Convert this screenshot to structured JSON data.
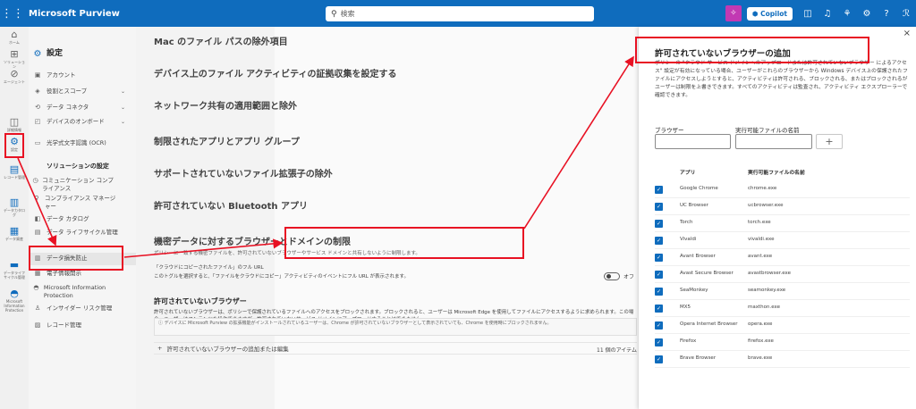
{
  "topbar": {
    "app_name": "Microsoft Purview",
    "search_placeholder": "検索",
    "copilot_label": "Copilot",
    "accent": "#0f6cbd"
  },
  "rail": {
    "items": [
      {
        "icon": "home-icon",
        "label": "ホーム"
      },
      {
        "icon": "solutions-icon",
        "label": "ソリューション"
      },
      {
        "icon": "agents-icon",
        "label": "エージェント"
      },
      {
        "icon": "explorer-icon",
        "label": "詳細情報"
      },
      {
        "icon": "settings-icon",
        "label": "設定"
      },
      {
        "icon": "records-icon",
        "label": "レコード管理"
      },
      {
        "icon": "catalog-icon",
        "label": "データカタログ"
      },
      {
        "icon": "lifecycle-icon",
        "label": "データ資産"
      },
      {
        "icon": "dlp-icon",
        "label": "データライフサイクル管理"
      },
      {
        "icon": "mip-icon",
        "label": "Microsoft Information Protection"
      }
    ]
  },
  "nav": {
    "title": "設定",
    "items": [
      {
        "icon": "account-icon",
        "label": "アカウント"
      },
      {
        "icon": "roles-icon",
        "label": "役割とスコープ"
      },
      {
        "icon": "connector-icon",
        "label": "データ コネクタ"
      },
      {
        "icon": "device-icon",
        "label": "デバイスのオンボード"
      },
      {
        "icon": "ocr-icon",
        "label": "光学式文字認識 (OCR)"
      }
    ],
    "solutions_header": "ソリューションの設定",
    "solutions": [
      {
        "icon": "comm-icon",
        "label": "コミュニケーション コンプライアンス"
      },
      {
        "icon": "compliance-icon",
        "label": "コンプライアンス マネージャー"
      },
      {
        "icon": "catalog-icon",
        "label": "データ カタログ"
      },
      {
        "icon": "lifecycle-icon",
        "label": "データ ライフサイクル管理"
      },
      {
        "icon": "dlp-icon",
        "label": "データ損失防止"
      },
      {
        "icon": "ediscovery-icon",
        "label": "電子情報開示"
      },
      {
        "icon": "mip-icon",
        "label": "Microsoft Information Protection"
      },
      {
        "icon": "insider-icon",
        "label": "インサイダー リスク管理"
      },
      {
        "icon": "records-icon",
        "label": "レコード管理"
      }
    ]
  },
  "main": {
    "sections": [
      "Mac のファイル パスの除外項目",
      "デバイス上のファイル アクティビティの証拠収集を設定する",
      "ネットワーク共有の適用範囲と除外",
      "制限されたアプリとアプリ グループ",
      "サポートされていないファイル拡張子の除外",
      "許可されていない Bluetooth アプリ"
    ],
    "highlight_title": "機密データに対するブラウザーとドメインの制限",
    "highlight_sub": "ポリシーに一致する機密ファイルを、許可されていないブラウザーやサービス ドメインと共有しないように制限します。",
    "fullurl_label": "「クラウドにコピーされたファイル」のフル URL",
    "fullurl_desc": "このトグルを選択すると、「ファイルをクラウドにコピー」アクティビティのイベントにフル URL が表示されます。",
    "toggle_label": "オフ",
    "unallowed_header": "許可されていないブラウザー",
    "unallowed_desc": "許可されていないブラウザーは、ポリシーで保護されているファイルへのアクセスをブロックされます。ブロックされると、ユーザーは Microsoft Edge を使用してファイルにアクセスするように求められます。この場合、ユーザーはコンテンツを操作できますが、許可されていないサービス ドメインにアップロードすることはできません。",
    "info_text": "デバイスに Microsoft Purview の拡張機能がインストールされているユーザーは、Chrome が許可されていないブラウザーとして表示されていても、Chrome を使用時にブロックされません。",
    "add_edit_label": "許可されていないブラウザーの追加または編集",
    "count_label": "11 個のアイテム"
  },
  "panel": {
    "title": "許可されていないブラウザーの追加",
    "description": "ポリシーの \"クラウド サービス ドメインへのアップロードまたは許可されていないブラウザー によるアクセス\" 設定が有効になっている場合、ユーザーがこれらのブラウザーから Windows デバイス上の保護されたファイルにアクセスしようとすると、アクティビティは許可される、ブロックされる、またはブロックされるがユーザーは制限を上書きできます。すべてのアクティビティは監査され、アクティビティ エクスプローラーで確認できます。",
    "browser_label": "ブラウザー",
    "exe_label": "実行可能ファイルの名前",
    "col_app": "アプリ",
    "col_exe": "実行可能ファイルの名前",
    "rows": [
      {
        "browser": "Google Chrome",
        "exe": "chrome.exe"
      },
      {
        "browser": "UC Browser",
        "exe": "ucbrowser.exe"
      },
      {
        "browser": "Torch",
        "exe": "torch.exe"
      },
      {
        "browser": "Vivaldi",
        "exe": "vivaldi.exe"
      },
      {
        "browser": "Avant Browser",
        "exe": "avant.exe"
      },
      {
        "browser": "Avast Secure Browser",
        "exe": "avastbrowser.exe"
      },
      {
        "browser": "SeaMonkey",
        "exe": "seamonkey.exe"
      },
      {
        "browser": "MX5",
        "exe": "maxthon.exe"
      },
      {
        "browser": "Opera Internet Browser",
        "exe": "opera.exe"
      },
      {
        "browser": "Firefox",
        "exe": "firefox.exe"
      },
      {
        "browser": "Brave Browser",
        "exe": "brave.exe"
      }
    ]
  },
  "annotation_color": "#e81123"
}
